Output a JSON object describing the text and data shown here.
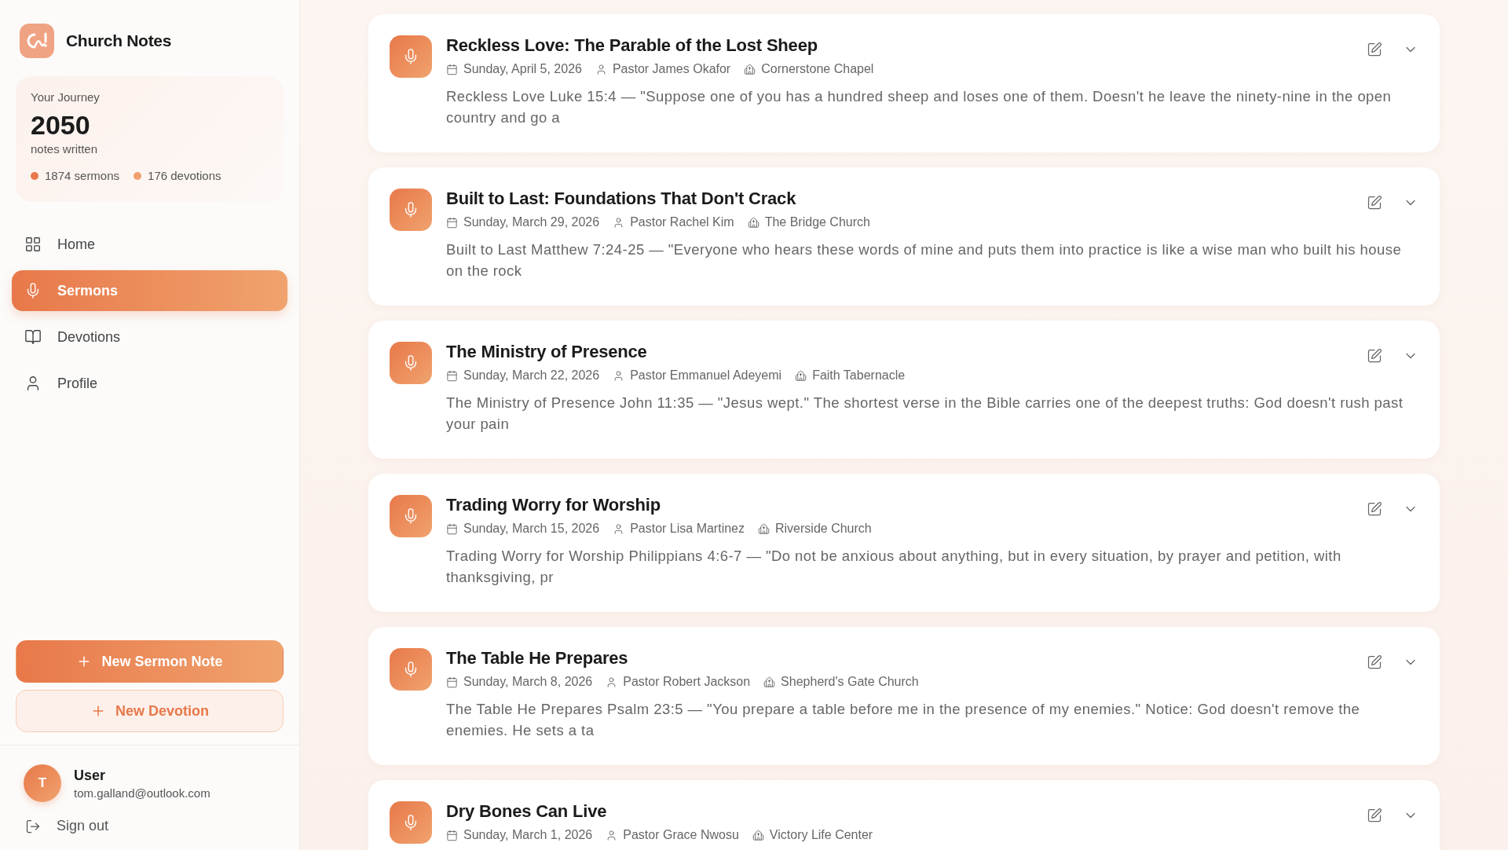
{
  "app": {
    "name": "Church Notes"
  },
  "journey": {
    "label": "Your Journey",
    "count": "2050",
    "caption": "notes written",
    "stats": [
      {
        "text": "1874 sermons",
        "color": "#e8784a"
      },
      {
        "text": "176 devotions",
        "color": "#f0a070"
      }
    ]
  },
  "nav": [
    {
      "label": "Home",
      "selected": false
    },
    {
      "label": "Sermons",
      "selected": true
    },
    {
      "label": "Devotions",
      "selected": false
    },
    {
      "label": "Profile",
      "selected": false
    }
  ],
  "actions": [
    {
      "label": "New Sermon Note",
      "kind": "primary"
    },
    {
      "label": "New Devotion",
      "kind": "secondary"
    }
  ],
  "user": {
    "initial": "T",
    "name": "User",
    "email": "tom.galland@outlook.com"
  },
  "sign_out": "Sign out",
  "notes": [
    {
      "title": "Reckless Love: The Parable of the Lost Sheep",
      "date": "Sunday, April 5, 2026",
      "speaker": "Pastor James Okafor",
      "church": "Cornerstone Chapel",
      "excerpt": "Reckless Love Luke 15:4 — \"Suppose one of you has a hundred sheep and loses one of them. Doesn't he leave the ninety-nine in the open country and go a"
    },
    {
      "title": "Built to Last: Foundations That Don't Crack",
      "date": "Sunday, March 29, 2026",
      "speaker": "Pastor Rachel Kim",
      "church": "The Bridge Church",
      "excerpt": "Built to Last Matthew 7:24-25 — \"Everyone who hears these words of mine and puts them into practice is like a wise man who built his house on the rock"
    },
    {
      "title": "The Ministry of Presence",
      "date": "Sunday, March 22, 2026",
      "speaker": "Pastor Emmanuel Adeyemi",
      "church": "Faith Tabernacle",
      "excerpt": "The Ministry of Presence John 11:35 — \"Jesus wept.\" The shortest verse in the Bible carries one of the deepest truths: God doesn't rush past your pain"
    },
    {
      "title": "Trading Worry for Worship",
      "date": "Sunday, March 15, 2026",
      "speaker": "Pastor Lisa Martinez",
      "church": "Riverside Church",
      "excerpt": "Trading Worry for Worship Philippians 4:6-7 — \"Do not be anxious about anything, but in every situation, by prayer and petition, with thanksgiving, pr"
    },
    {
      "title": "The Table He Prepares",
      "date": "Sunday, March 8, 2026",
      "speaker": "Pastor Robert Jackson",
      "church": "Shepherd's Gate Church",
      "excerpt": "The Table He Prepares Psalm 23:5 — \"You prepare a table before me in the presence of my enemies.\" Notice: God doesn't remove the enemies. He sets a ta"
    },
    {
      "title": "Dry Bones Can Live",
      "date": "Sunday, March 1, 2026",
      "speaker": "Pastor Grace Nwosu",
      "church": "Victory Life Center"
    }
  ]
}
